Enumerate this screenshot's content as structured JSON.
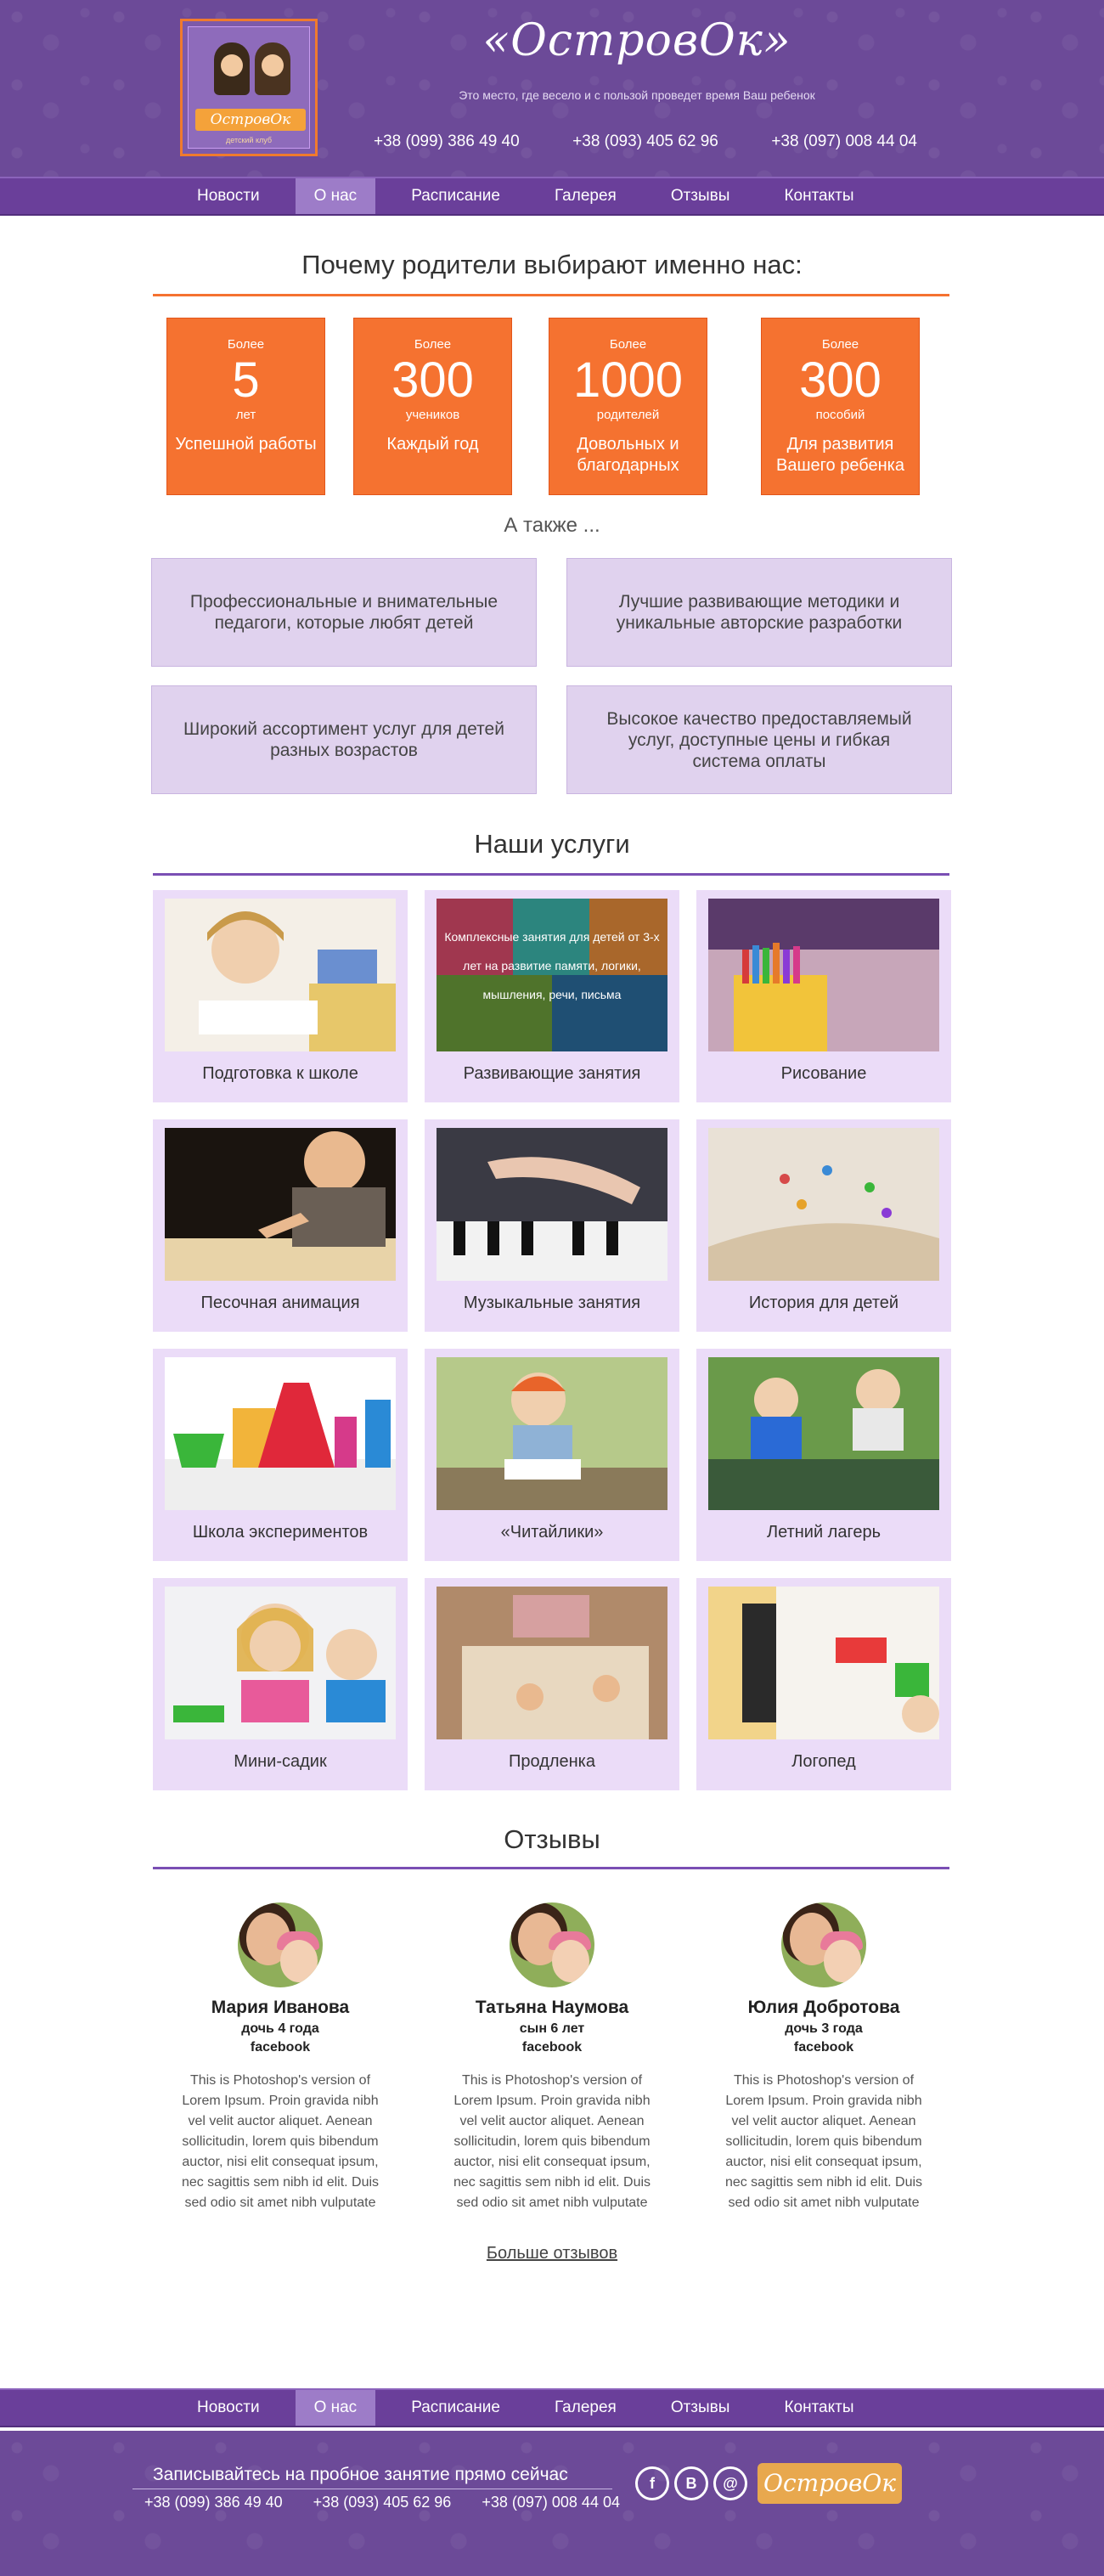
{
  "header": {
    "logo_text": "ОстровОк",
    "logo_sub": "детский клуб",
    "title": "«ОстровОк»",
    "tagline": "Это место, где весело и с пользой проведет время Ваш ребенок",
    "phones": [
      "+38 (099) 386 49 40",
      "+38 (093) 405 62 96",
      "+38 (097) 008 44 04"
    ]
  },
  "nav": {
    "items": [
      "Новости",
      "О нас",
      "Расписание",
      "Галерея",
      "Отзывы",
      "Контакты"
    ],
    "active": "О нас"
  },
  "why": {
    "title": "Почему родители выбирают именно нас:",
    "stats": [
      {
        "pre": "Более",
        "num": "5",
        "unit": "лет",
        "desc": "Успешной работы"
      },
      {
        "pre": "Более",
        "num": "300",
        "unit": "учеников",
        "desc": "Каждый год"
      },
      {
        "pre": "Более",
        "num": "1000",
        "unit": "родителей",
        "desc": "Довольных и благодарных"
      },
      {
        "pre": "Более",
        "num": "300",
        "unit": "пособий",
        "desc": "Для развития Вашего ребенка"
      }
    ],
    "also": "А также ...",
    "features": [
      "Профессиональные и внимательные педагоги, которые любят детей",
      "Лучшие развивающие методики и уникальные авторские разработки",
      "Широкий ассортимент услуг для детей разных возрастов",
      "Высокое качество предоставляемый услуг, доступные цены и гибкая система оплаты"
    ]
  },
  "services": {
    "title": "Наши услуги",
    "overlay": "Комплексные занятия для детей от 3-х лет на развитие памяти, логики, мышления, речи, письма",
    "items": [
      "Подготовка к школе",
      "Развивающие занятия",
      "Рисование",
      "Песочная анимация",
      "Музыкальные занятия",
      "История для детей",
      "Школа экспериментов",
      "«Читайлики»",
      "Летний лагерь",
      "Мини-садик",
      "Продленка",
      "Логопед"
    ]
  },
  "reviews": {
    "title": "Отзывы",
    "items": [
      {
        "name": "Мария Иванова",
        "child": "дочь 4 года",
        "source": "facebook",
        "text": "This is Photoshop's version  of Lorem Ipsum. Proin gravida nibh vel velit auctor aliquet. Aenean sollicitudin, lorem quis bibendum auctor, nisi elit consequat ipsum, nec sagittis sem nibh id elit. Duis sed odio sit amet nibh vulputate"
      },
      {
        "name": "Татьяна Наумова",
        "child": "сын 6 лет",
        "source": "facebook",
        "text": "This is Photoshop's version  of Lorem Ipsum. Proin gravida nibh vel velit auctor aliquet. Aenean sollicitudin, lorem quis bibendum auctor, nisi elit consequat ipsum, nec sagittis sem nibh id elit. Duis sed odio sit amet nibh vulputate"
      },
      {
        "name": "Юлия Добротова",
        "child": "дочь 3 года",
        "source": "facebook",
        "text": "This is Photoshop's version  of Lorem Ipsum. Proin gravida nibh vel velit auctor aliquet. Aenean sollicitudin, lorem quis bibendum auctor, nisi elit consequat ipsum, nec sagittis sem nibh id elit. Duis sed odio sit amet nibh vulputate"
      }
    ],
    "more": "Больше отзывов"
  },
  "footer": {
    "cta": "Записывайтесь на пробное занятие прямо сейчас",
    "phones": [
      "+38 (099) 386 49 40",
      "+38 (093) 405 62 96",
      "+38 (097) 008 44 04"
    ],
    "social": [
      "f",
      "B",
      "@"
    ],
    "logo_text": "ОстровОк"
  },
  "colors": {
    "purple": "#6c4a98",
    "nav": "#6a3f9a",
    "nav_active": "#9d7cc8",
    "orange": "#f57230",
    "lavender": "#e0d2ee",
    "service_bg": "#ebdcf8"
  },
  "icons": [
    "logo-icon",
    "facebook-icon",
    "vk-icon",
    "email-icon"
  ]
}
